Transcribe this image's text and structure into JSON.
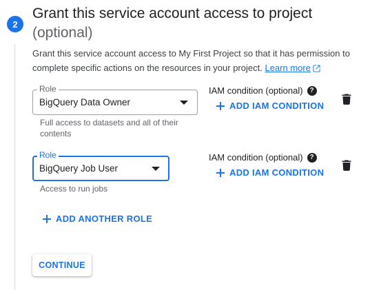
{
  "step": {
    "number": "2",
    "title": "Grant this service account access to project",
    "title_optional": "(optional)",
    "description": "Grant this service account access to My First Project so that it has permission to complete specific actions on the resources in your project.",
    "learn_more_label": "Learn more"
  },
  "roles": [
    {
      "label": "Role",
      "value": "BigQuery Data Owner",
      "hint": "Full access to datasets and all of their contents",
      "iam_condition_label": "IAM condition (optional)",
      "add_iam_label": "ADD IAM CONDITION"
    },
    {
      "label": "Role",
      "value": "BigQuery Job User",
      "hint": "Access to run jobs",
      "iam_condition_label": "IAM condition (optional)",
      "add_iam_label": "ADD IAM CONDITION"
    }
  ],
  "add_another_role_label": "ADD ANOTHER ROLE",
  "continue_label": "CONTINUE",
  "colors": {
    "accent": "#1a73e8",
    "text": "#202124",
    "secondary_text": "#5f6368",
    "border": "#9aa0a6"
  }
}
